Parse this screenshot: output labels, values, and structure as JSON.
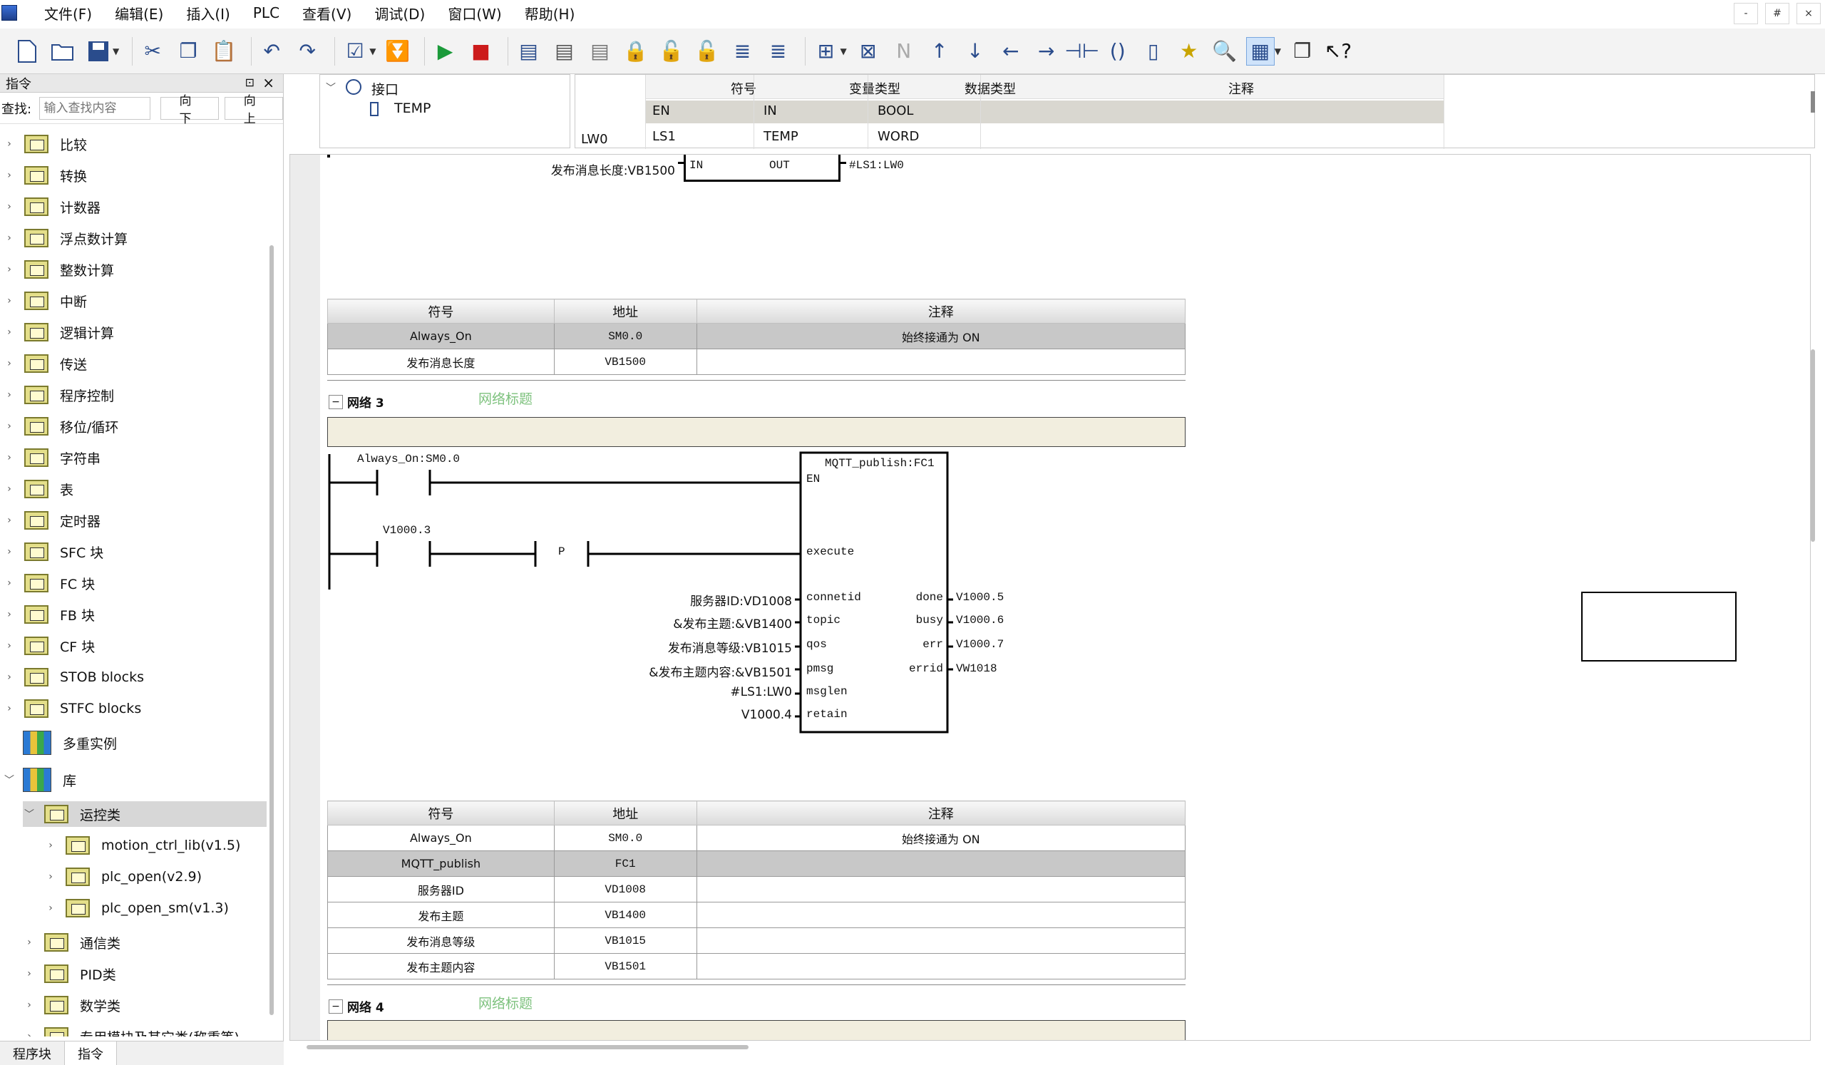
{
  "menu": [
    "文件(F)",
    "编辑(E)",
    "插入(I)",
    "PLC",
    "查看(V)",
    "调试(D)",
    "窗口(W)",
    "帮助(H)"
  ],
  "window_controls": [
    "-",
    "#",
    "×"
  ],
  "left_panel": {
    "title": "指令",
    "search_label": "查找:",
    "search_placeholder": "输入查找内容",
    "btn_down": "向下",
    "btn_up": "向上",
    "items": [
      "比较",
      "转换",
      "计数器",
      "浮点数计算",
      "整数计算",
      "中断",
      "逻辑计算",
      "传送",
      "程序控制",
      "移位/循环",
      "字符串",
      "表",
      "定时器",
      "SFC 块",
      "FC 块",
      "FB 块",
      "CF 块",
      "STOB blocks",
      "STFC blocks",
      "多重实例",
      "库",
      "运控类",
      "motion_ctrl_lib(v1.5)",
      "plc_open(v2.9)",
      "plc_open_sm(v1.3)",
      "通信类",
      "PID类",
      "数学类",
      "专用模块及其它类(称重等)"
    ]
  },
  "bottom_tabs": [
    "程序块",
    "指令"
  ],
  "interface": {
    "root": "接口",
    "child": "TEMP",
    "headers": [
      "符号",
      "变量类型",
      "数据类型",
      "注释"
    ],
    "rows": [
      {
        "addr": "",
        "sym": "EN",
        "vtype": "IN",
        "dtype": "BOOL",
        "comment": ""
      },
      {
        "addr": "LW0",
        "sym": "LS1",
        "vtype": "TEMP",
        "dtype": "WORD",
        "comment": ""
      }
    ]
  },
  "network2_tail": {
    "in_label": "发布消息长度:VB1500",
    "pin_in": "IN",
    "pin_out": "OUT",
    "out_label": "#LS1:LW0"
  },
  "table1": {
    "headers": [
      "符号",
      "地址",
      "注释"
    ],
    "rows": [
      [
        "Always_On",
        "SM0.0",
        "始终接通为 ON"
      ],
      [
        "发布消息长度",
        "VB1500",
        ""
      ]
    ]
  },
  "network3": {
    "label": "网络 3",
    "title_placeholder": "网络标题",
    "contact1": "Always_On:SM0.0",
    "contact2": "V1000.3",
    "p_label": "P",
    "block_name": "MQTT_publish:FC1",
    "pin_en": "EN",
    "pin_execute": "execute",
    "inputs": [
      {
        "label": "服务器ID:VD1008",
        "pin": "connetid"
      },
      {
        "label": "&发布主题:&VB1400",
        "pin": "topic"
      },
      {
        "label": "发布消息等级:VB1015",
        "pin": "qos"
      },
      {
        "label": "&发布主题内容:&VB1501",
        "pin": "pmsg"
      },
      {
        "label": "#LS1:LW0",
        "pin": "msglen"
      },
      {
        "label": "V1000.4",
        "pin": "retain"
      }
    ],
    "outputs": [
      {
        "pin": "done",
        "label": "V1000.5"
      },
      {
        "pin": "busy",
        "label": "V1000.6"
      },
      {
        "pin": "err",
        "label": "V1000.7"
      },
      {
        "pin": "errid",
        "label": "VW1018"
      }
    ]
  },
  "table2": {
    "headers": [
      "符号",
      "地址",
      "注释"
    ],
    "rows": [
      [
        "Always_On",
        "SM0.0",
        "始终接通为 ON"
      ],
      [
        "MQTT_publish",
        "FC1",
        ""
      ],
      [
        "服务器ID",
        "VD1008",
        ""
      ],
      [
        "发布主题",
        "VB1400",
        ""
      ],
      [
        "发布消息等级",
        "VB1015",
        ""
      ],
      [
        "发布主题内容",
        "VB1501",
        ""
      ]
    ]
  },
  "network4": {
    "label": "网络 4",
    "title_placeholder": "网络标题"
  }
}
